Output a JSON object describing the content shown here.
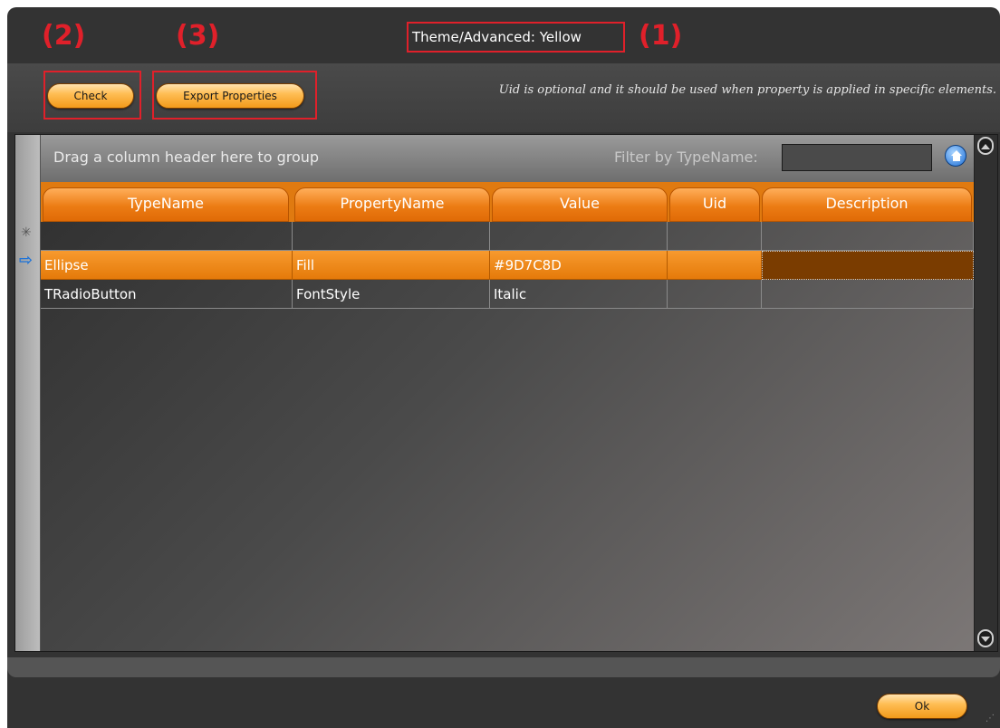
{
  "window": {
    "title": "Theme/Advanced: Yellow"
  },
  "annotations": [
    "(1)",
    "(2)",
    "(3)"
  ],
  "toolbar": {
    "check_label": "Check",
    "export_label": "Export Properties",
    "hint": "Uid is optional and it should be used when property is applied in specific elements."
  },
  "grid": {
    "group_text": "Drag a column header here to group",
    "filter_label": "Filter by TypeName:",
    "filter_value": "",
    "columns": [
      "TypeName",
      "PropertyName",
      "Value",
      "Uid",
      "Description"
    ],
    "new_row_symbol": "✳",
    "current_row_symbol": "⇨",
    "rows": [
      {
        "TypeName": "Ellipse",
        "PropertyName": "Fill",
        "Value": "#9D7C8D",
        "Uid": "",
        "Description": ""
      },
      {
        "TypeName": "TRadioButton",
        "PropertyName": "FontStyle",
        "Value": "Italic",
        "Uid": "",
        "Description": ""
      }
    ]
  },
  "footer": {
    "ok_label": "Ok"
  },
  "colors": {
    "accent": "#ec7c14",
    "annotation": "#e0202a",
    "window": "#333333"
  }
}
